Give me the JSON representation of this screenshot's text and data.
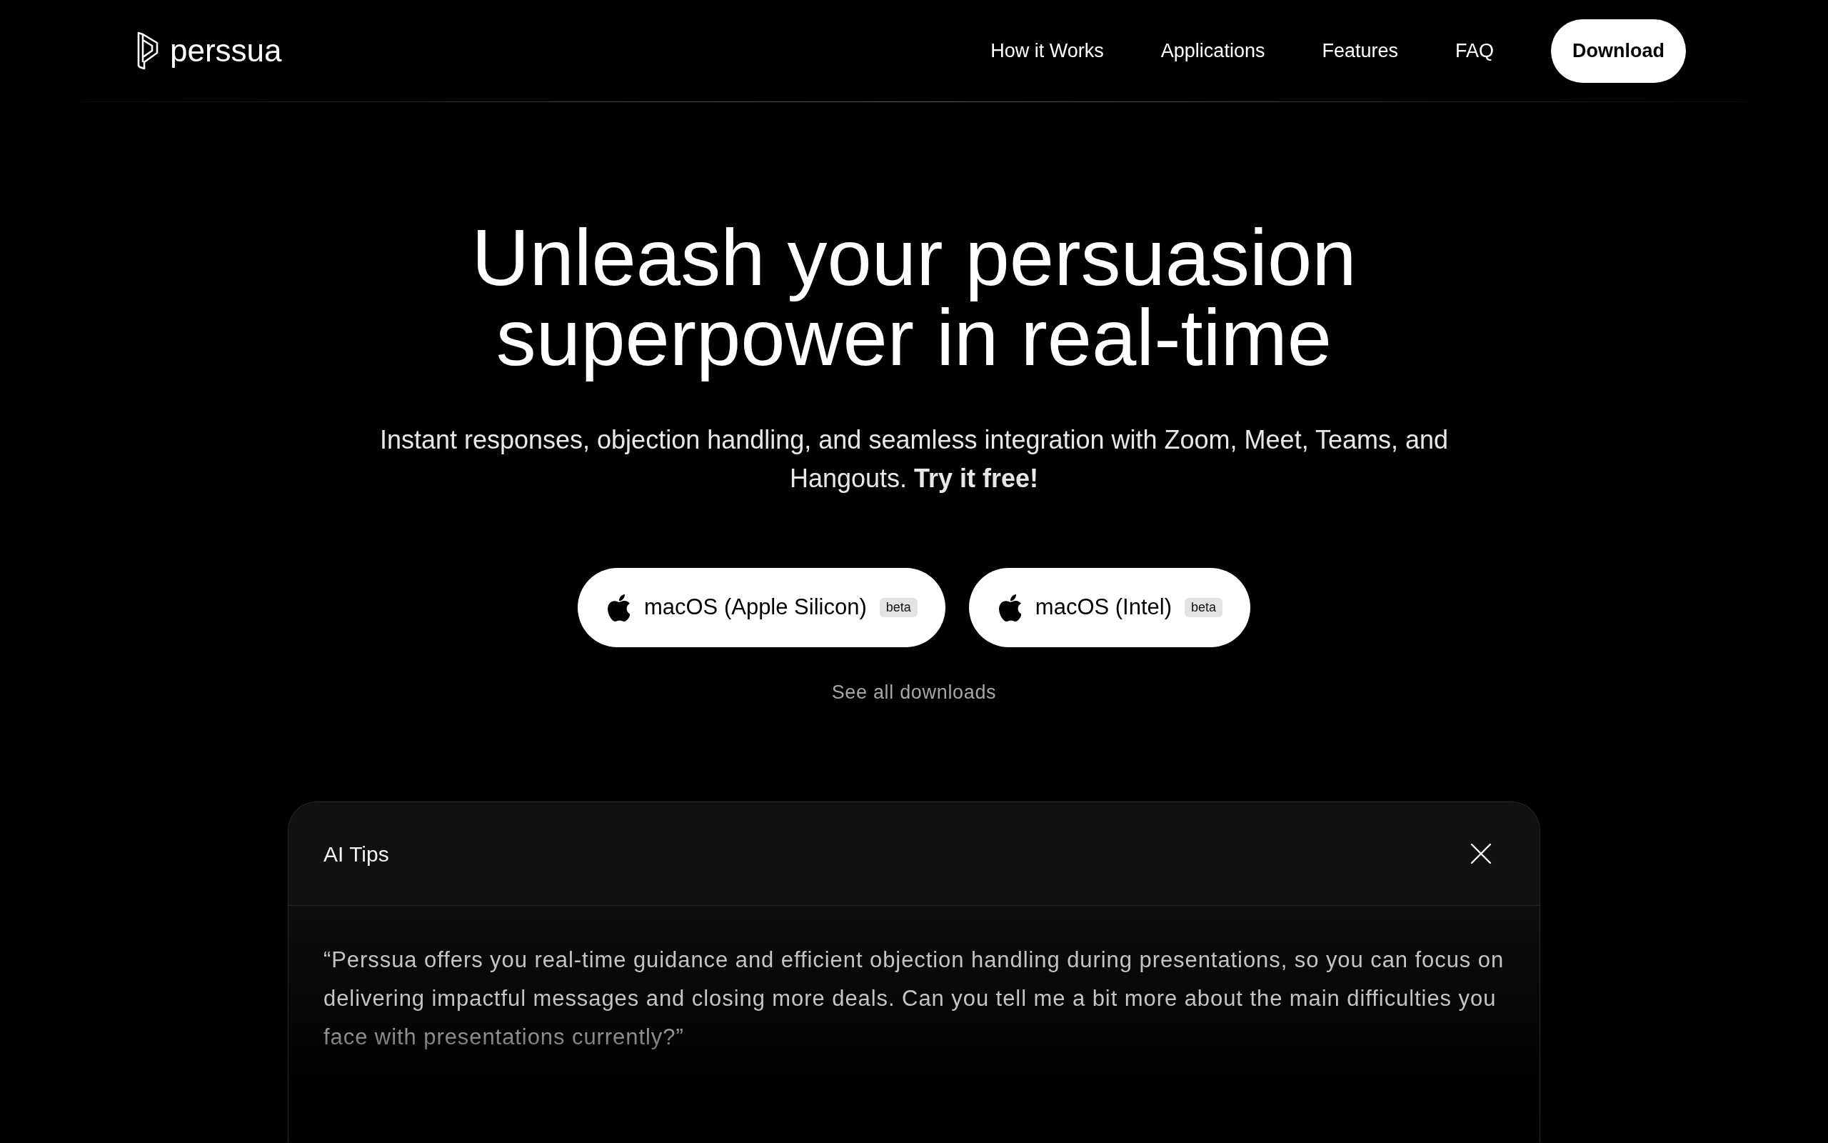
{
  "header": {
    "logo": {
      "text": "perssua"
    },
    "nav": [
      {
        "label": "How it Works"
      },
      {
        "label": "Applications"
      },
      {
        "label": "Features"
      },
      {
        "label": "FAQ"
      }
    ],
    "cta": {
      "label": "Download"
    }
  },
  "hero": {
    "title": "Unleash your persuasion superpower in real-time",
    "subtitle": "Instant responses, objection handling, and seamless integration with Zoom, Meet, Teams, and Hangouts. **Try it free!**",
    "downloads": [
      {
        "label": "macOS (Apple Silicon)",
        "badge": "beta"
      },
      {
        "label": "macOS (Intel)",
        "badge": "beta"
      }
    ],
    "all_downloads_link": "See all downloads"
  },
  "tips_panel": {
    "title": "AI Tips",
    "message": "“Perssua offers you real-time guidance and efficient objection handling during presentations, so you can focus on delivering impactful messages and closing more deals. Can you tell me a bit more about the main difficulties you face with presentations currently?”"
  }
}
